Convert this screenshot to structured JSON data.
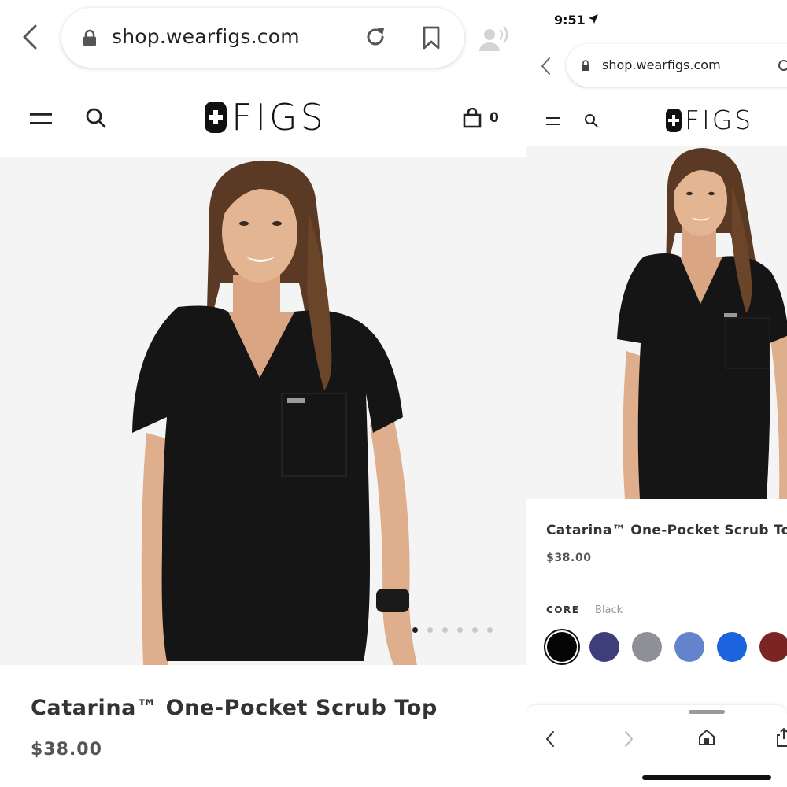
{
  "left": {
    "browser": {
      "url": "shop.wearfigs.com",
      "icons": [
        "back-chevron-icon",
        "lock-icon",
        "reload-icon",
        "bookmark-icon",
        "voice-icon"
      ]
    },
    "header": {
      "logo_text": "FIGS",
      "cart_count": "0",
      "icons": [
        "menu-icon",
        "search-icon",
        "bag-icon"
      ]
    },
    "product": {
      "title": "Catarina™ One-Pocket Scrub Top",
      "price": "$38.00",
      "carousel": {
        "count": 6,
        "active": 0
      }
    }
  },
  "right": {
    "status": {
      "time": "9:51"
    },
    "browser": {
      "url": "shop.wearfigs.com"
    },
    "header": {
      "logo_text": "FIGS"
    },
    "product": {
      "title": "Catarina™ One-Pocket Scrub To",
      "price": "$38.00",
      "color_group": "CORE",
      "selected_color": "Black",
      "swatches": [
        {
          "color": "#050505",
          "selected": true
        },
        {
          "color": "#3e3f7a",
          "selected": false
        },
        {
          "color": "#8f9096",
          "selected": false
        },
        {
          "color": "#6383cc",
          "selected": false
        },
        {
          "color": "#1c63de",
          "selected": false
        },
        {
          "color": "#7a2424",
          "selected": false
        }
      ]
    },
    "toolbar": {
      "icons": [
        "back-icon",
        "forward-icon",
        "home-icon",
        "share-icon"
      ]
    }
  },
  "colors": {
    "photo_bg": "#f4f4f4",
    "scrub": "#151515",
    "skin": "#dfae8c",
    "hair": "#5a3a24"
  }
}
